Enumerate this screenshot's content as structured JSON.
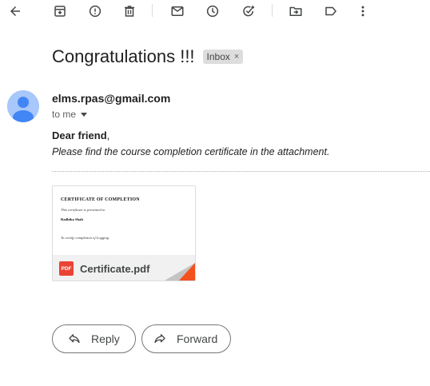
{
  "toolbar": {
    "icons": [
      "back-icon",
      "archive-icon",
      "report-spam-icon",
      "delete-icon",
      "mark-unread-icon",
      "snooze-icon",
      "add-task-icon",
      "move-to-icon",
      "label-icon",
      "more-options-icon"
    ]
  },
  "email": {
    "subject": "Congratulations !!!",
    "label": "Inbox",
    "label_remove": "×",
    "sender": "elms.rpas@gmail.com",
    "recipient": "to me",
    "greeting_bold": "Dear friend",
    "greeting_rest": ",",
    "body": "Please find the course completion certificate in the attachment."
  },
  "attachment": {
    "preview": {
      "title": "CERTIFICATE OF COMPLETION",
      "line2": "This certificate is presented to",
      "recipient_name": "Radhika Shah",
      "line4": "To certify completion of Logging"
    },
    "badge": "PDF",
    "filename": "Certificate.pdf"
  },
  "actions": {
    "reply": "Reply",
    "forward": "Forward"
  },
  "colors": {
    "avatar_bg": "#a8c7fa",
    "avatar_fg": "#4285f4",
    "pdf_red": "#ea4335",
    "fold_orange": "#f4511e",
    "fold_gray": "#c4c4c4"
  }
}
